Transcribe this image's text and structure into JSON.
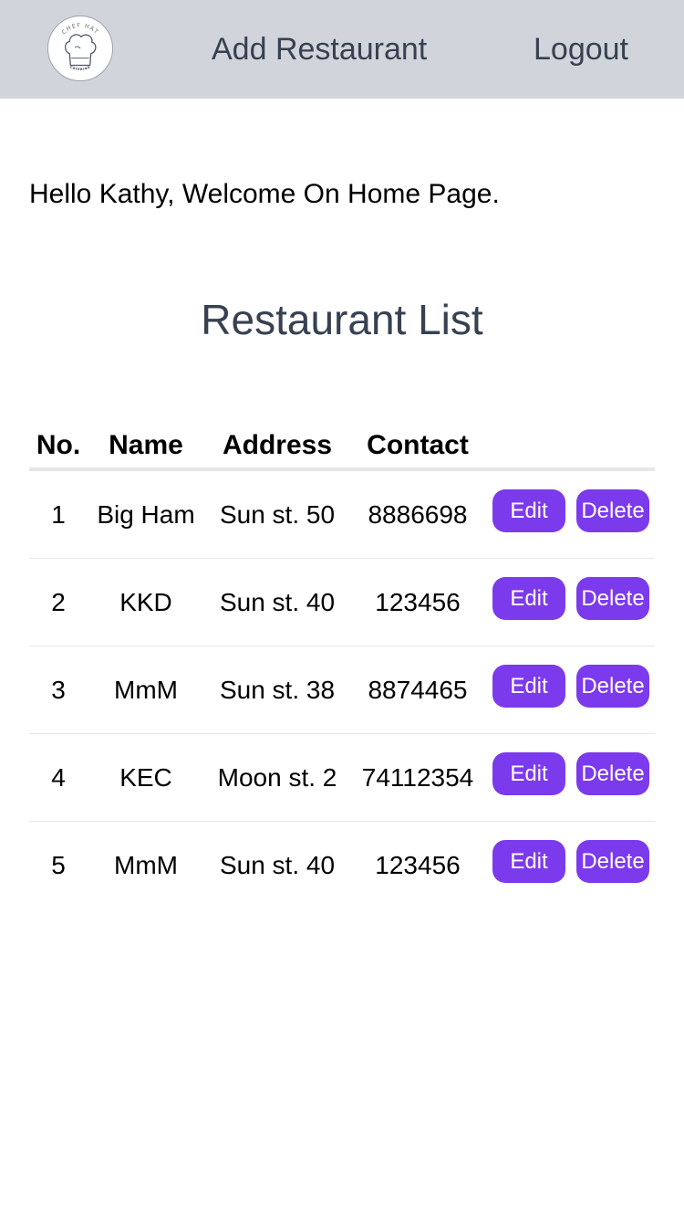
{
  "navbar": {
    "logo_icon": "chef-hat-catering-logo",
    "logo_text_top": "CHEF HAT",
    "logo_text_bottom": "CATERING",
    "add_restaurant": "Add Restaurant",
    "logout": "Logout",
    "background": "#d1d5db"
  },
  "welcome": "Hello Kathy, Welcome On Home Page.",
  "title": "Restaurant List",
  "table": {
    "headers": [
      "No.",
      "Name",
      "Address",
      "Contact"
    ],
    "edit_label": "Edit",
    "delete_label": "Delete",
    "rows": [
      {
        "no": "1",
        "name": "Big Ham",
        "address": "Sun st. 50",
        "contact": "8886698"
      },
      {
        "no": "2",
        "name": "KKD",
        "address": "Sun st. 40",
        "contact": "123456"
      },
      {
        "no": "3",
        "name": "MmM",
        "address": "Sun st. 38",
        "contact": "8874465"
      },
      {
        "no": "4",
        "name": "KEC",
        "address": "Moon st. 2",
        "contact": "74112354"
      },
      {
        "no": "5",
        "name": "MmM",
        "address": "Sun st. 40",
        "contact": "123456"
      }
    ]
  },
  "colors": {
    "accent": "#7c3aed",
    "nav_text": "#374151",
    "divider": "#e5e7eb"
  }
}
